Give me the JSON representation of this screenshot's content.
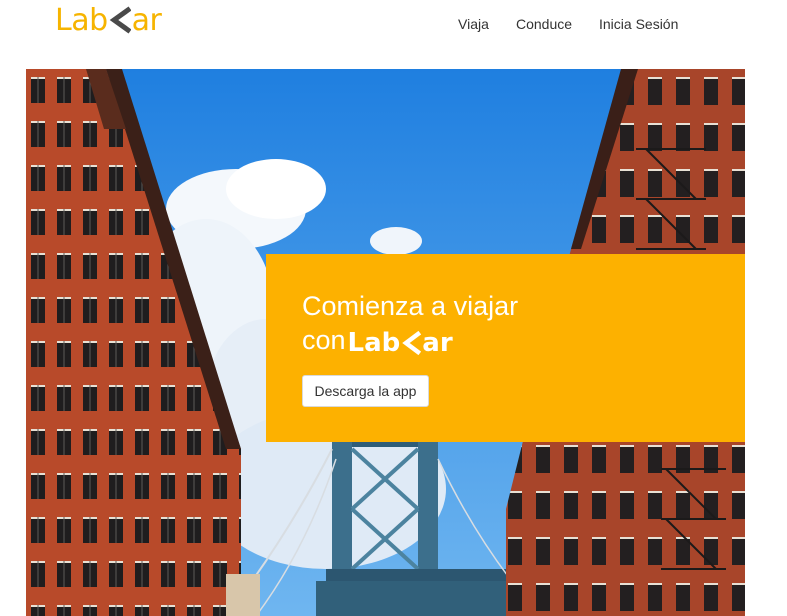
{
  "header": {
    "logo_parts": [
      "Lab",
      "ar"
    ],
    "nav": [
      {
        "label": "Viaja"
      },
      {
        "label": "Conduce"
      },
      {
        "label": "Inicia Sesión"
      }
    ]
  },
  "hero": {
    "title_line1": "Comienza a viajar",
    "title_line2_prefix": "con",
    "logo_parts": [
      "Lab",
      "ar"
    ],
    "download_button": "Descarga la app"
  },
  "colors": {
    "brand_yellow": "#fdb100",
    "logo_yellow": "#f6b400",
    "sky_blue": "#2a8fe8",
    "brick": "#b8502e"
  },
  "icons": {
    "logo_mark": "left-chevron-icon"
  }
}
